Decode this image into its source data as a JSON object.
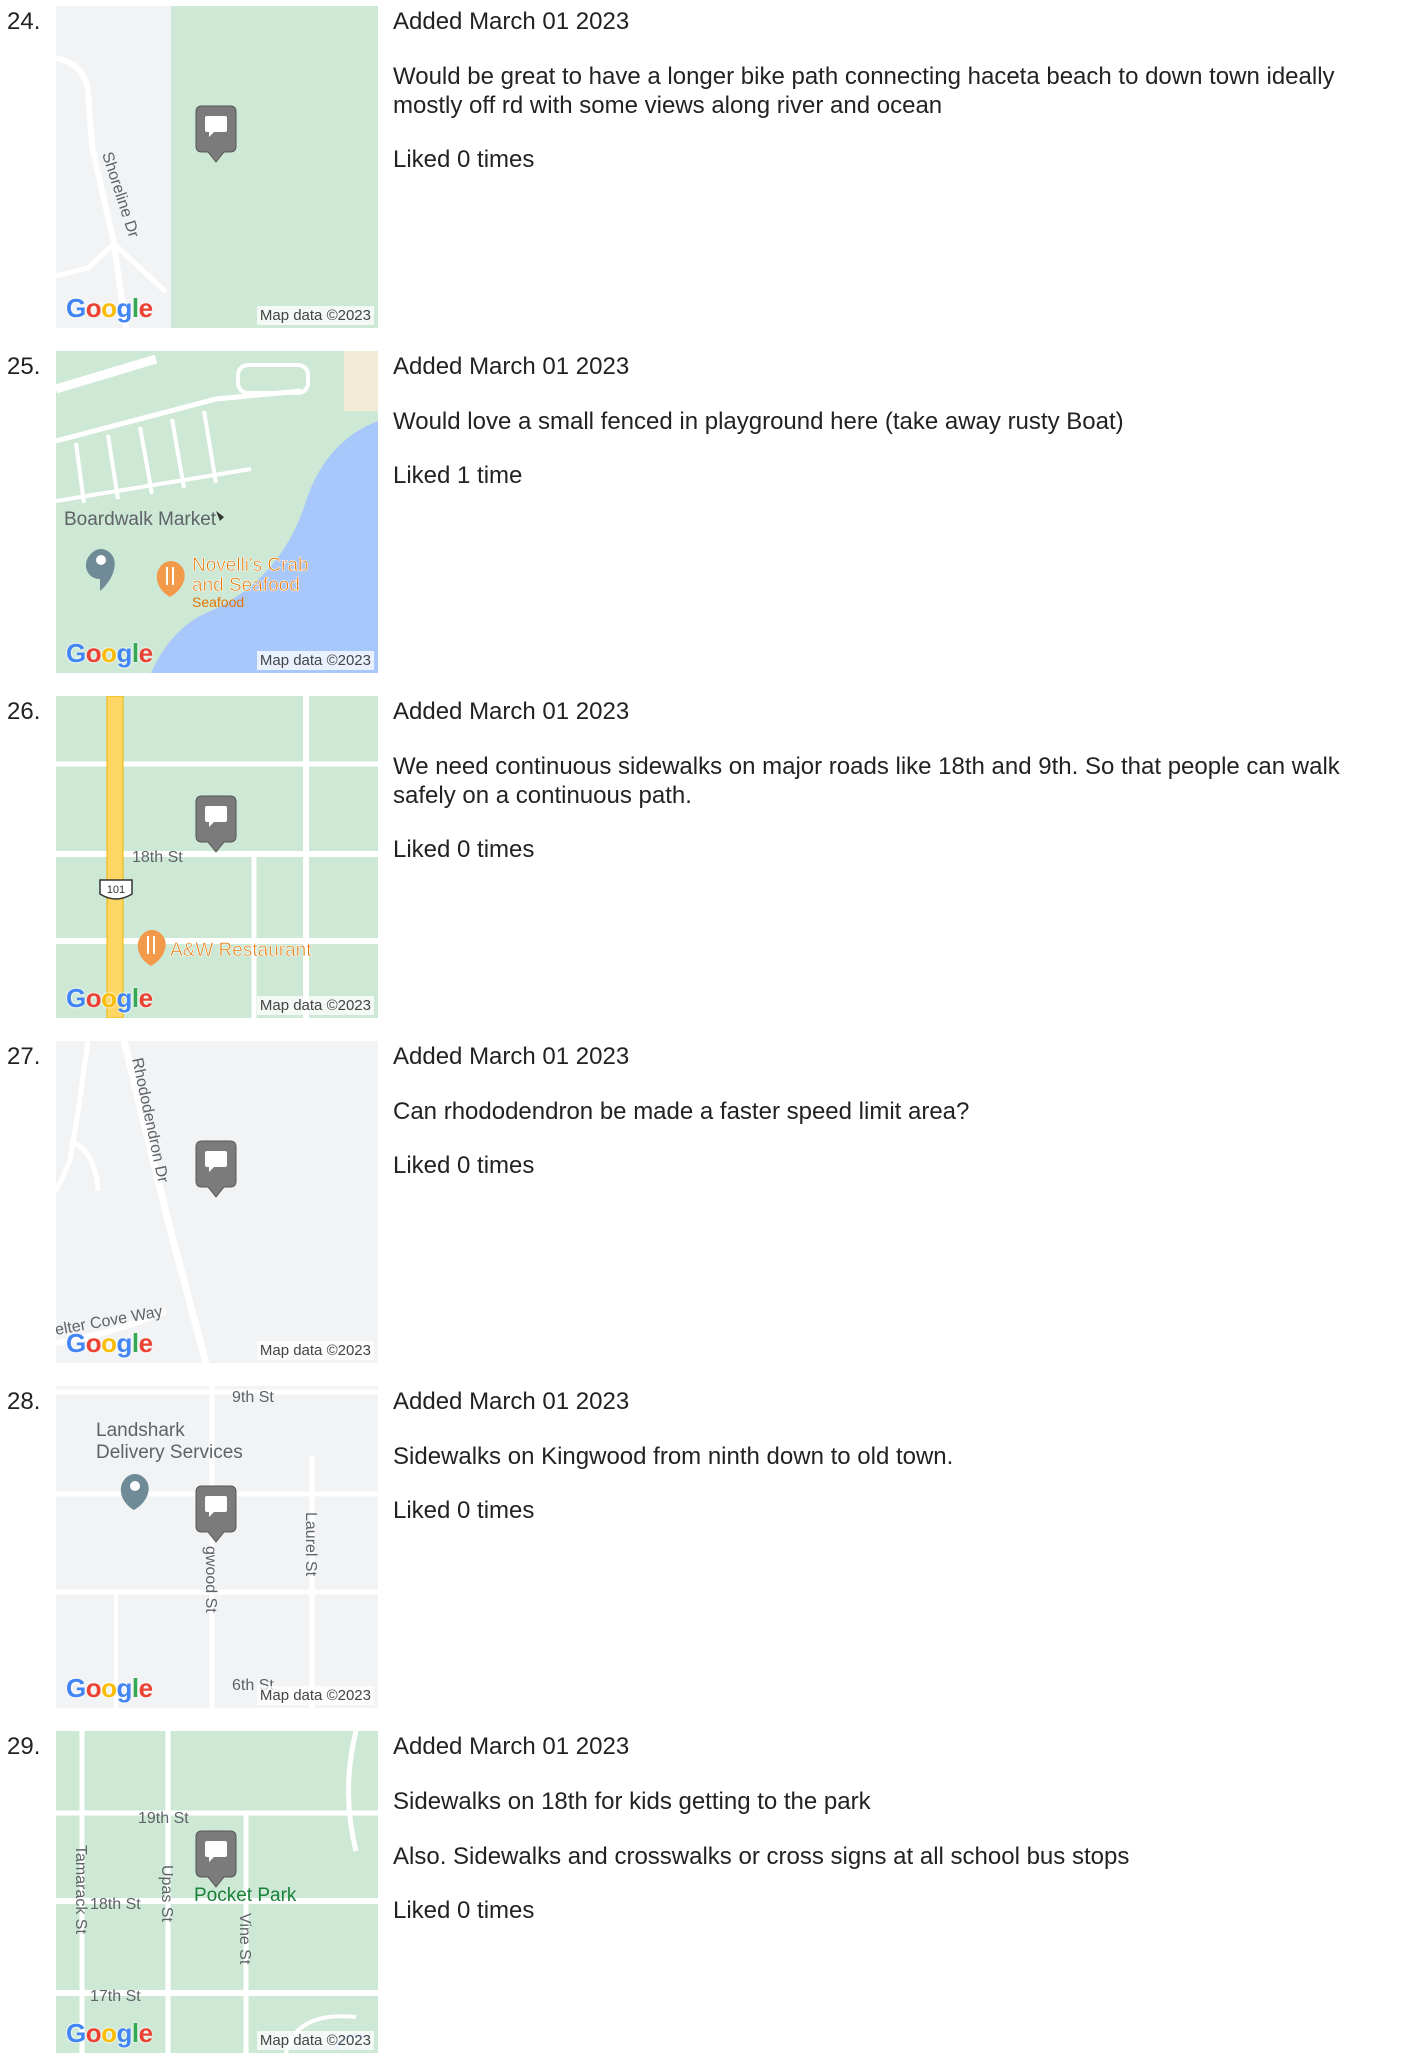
{
  "google": {
    "g1": "G",
    "o1": "o",
    "o2": "o",
    "g2": "g",
    "l": "l",
    "e": "e"
  },
  "entries": [
    {
      "number": "24.",
      "added": "Added March 01 2023",
      "comment": [
        "Would be great to have a longer bike path connecting haceta beach to down town ideally mostly off rd with some views along river and ocean"
      ],
      "liked": "Liked 0 times",
      "map": {
        "labels": [
          "Shoreline Dr"
        ],
        "attribution": "Map data ©2023"
      }
    },
    {
      "number": "25.",
      "added": "Added March 01 2023",
      "comment": [
        "Would love a small fenced in playground here (take away rusty Boat)"
      ],
      "liked": "Liked 1 time",
      "map": {
        "labels": [
          "Boardwalk Market",
          "Novelli's Crab",
          "and Seafood",
          "Seafood"
        ],
        "attribution": "Map data ©2023"
      }
    },
    {
      "number": "26.",
      "added": "Added March 01 2023",
      "comment": [
        "We need continuous sidewalks on major roads like 18th and 9th. So that people can walk safely on a continuous path."
      ],
      "liked": "Liked 0 times",
      "map": {
        "labels": [
          "18th St",
          "101",
          "A&W Restaurant"
        ],
        "attribution": "Map data ©2023"
      }
    },
    {
      "number": "27.",
      "added": "Added March 01 2023",
      "comment": [
        "Can rhododendron be made a faster speed limit area?"
      ],
      "liked": "Liked 0 times",
      "map": {
        "labels": [
          "Rhododendron Dr",
          "elter Cove Way"
        ],
        "attribution": "Map data ©2023"
      }
    },
    {
      "number": "28.",
      "added": "Added March 01 2023",
      "comment": [
        "Sidewalks on Kingwood from ninth down to old town."
      ],
      "liked": "Liked 0 times",
      "map": {
        "labels": [
          "9th St",
          "Landshark",
          "Delivery Services",
          "Laurel St",
          "gwood St",
          "6th St"
        ],
        "attribution": "Map data ©2023"
      }
    },
    {
      "number": "29.",
      "added": "Added March 01 2023",
      "comment": [
        "Sidewalks on 18th for kids getting to the park",
        "Also. Sidewalks and crosswalks or cross signs at all school bus stops"
      ],
      "liked": "Liked 0 times",
      "map": {
        "labels": [
          "19th St",
          "Tamarack St",
          "Upas St",
          "18th St",
          "Pocket Park",
          "Vine St",
          "17th St"
        ],
        "attribution": "Map data ©2023"
      }
    }
  ]
}
